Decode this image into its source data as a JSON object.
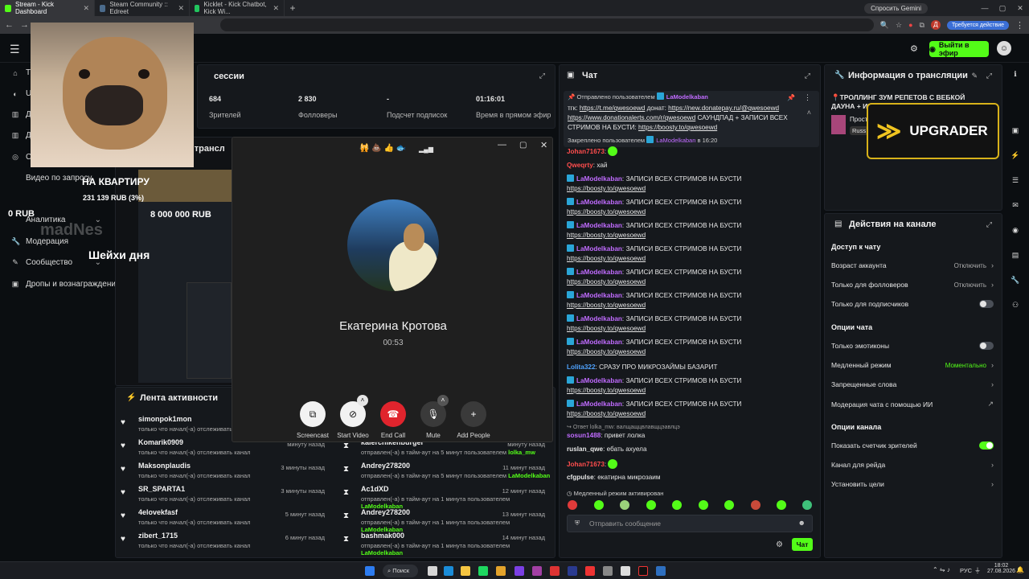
{
  "browser": {
    "tabs": [
      {
        "label": "Stream - Kick Dashboard",
        "color": "#53fc18",
        "active": true
      },
      {
        "label": "Steam Community :: Edreet",
        "color": "#1b2838",
        "active": false
      },
      {
        "label": "Kicklet - Kick Chatbot, Kick Wi...",
        "color": "#22c55e",
        "active": false
      }
    ],
    "gemini_label": "Спросить Gemini",
    "update_label": "Требуется действие"
  },
  "header": {
    "go_live_label": "Выйти в эфир"
  },
  "sidebar": {
    "items": [
      {
        "label": "Тр",
        "icon": "home-icon"
      },
      {
        "label": "Ul",
        "icon": "user-icon"
      },
      {
        "label": "Д",
        "icon": "chart-icon"
      },
      {
        "label": "Д",
        "icon": "chart-icon"
      },
      {
        "label": "Ст",
        "icon": "stream-icon"
      },
      {
        "label": "Видео по запросу",
        "icon": "video-icon"
      },
      {
        "label": "Аналитика",
        "icon": "analytics-icon"
      },
      {
        "label": "Модерация",
        "icon": "wrench-icon"
      },
      {
        "label": "Сообщество",
        "icon": "community-icon"
      },
      {
        "label": "Дропы и вознаграждения",
        "icon": "gift-icon"
      }
    ]
  },
  "overlay": {
    "goal_title": "НА КВАРТИРУ",
    "goal_progress": "231 139 RUB (3%)",
    "goal_target": "8 000 000 RUB",
    "balance": "0 RUB",
    "sub_text": "Шейхи дня",
    "watermark": "madNes"
  },
  "session": {
    "title": "сессии",
    "stats": [
      {
        "value": "684",
        "label": "Зрителей"
      },
      {
        "value": "2 830",
        "label": "Фолловеры"
      },
      {
        "value": "-",
        "label": "Подсчет подписок"
      },
      {
        "value": "01:16:01",
        "label": "Время в прямом эфир"
      }
    ]
  },
  "preview_title": "р трансл",
  "activity": {
    "title": "Лента активности",
    "follows": [
      {
        "name": "simonpok1mon",
        "desc": "только что начал(-а) отслеживать канал",
        "time": ""
      },
      {
        "name": "Komarik0909",
        "desc": "только что начал(-а) отслеживать канал",
        "time": "минуту назад"
      },
      {
        "name": "Maksonplaudis",
        "desc": "только что начал(-а) отслеживать канал",
        "time": "3 минуты назад"
      },
      {
        "name": "SR_SPARTA1",
        "desc": "только что начал(-а) отслеживать канал",
        "time": "3 минуты назад"
      },
      {
        "name": "4elovekfasf",
        "desc": "только что начал(-а) отслеживать канал",
        "time": "5 минут назад"
      },
      {
        "name": "zibert_1715",
        "desc": "только что начал(-а) отслеживать канал",
        "time": "6 минут назад"
      }
    ],
    "timeouts": [
      {
        "name": "kalerchikenburger",
        "desc": "отправлен(-а) в тайм-аут на 5 минут пользователем ",
        "mod": "lolka_mw",
        "time": "минуту назад"
      },
      {
        "name": "Andrey278200",
        "desc": "отправлен(-а) в тайм-аут на 5 минут пользователем ",
        "mod": "LaModelkaban",
        "time": "11 минут назад"
      },
      {
        "name": "Ac1dXD",
        "desc": "отправлен(-а) в тайм-аут на 1 минута пользователем ",
        "mod": "LaModelkaban",
        "time": "12 минут назад"
      },
      {
        "name": "Andrey278200",
        "desc": "отправлен(-а) в тайм-аут на 1 минута пользователем ",
        "mod": "LaModelkaban",
        "time": "13 минут назад"
      },
      {
        "name": "bashmak000",
        "desc": "отправлен(-а) в тайм-аут на 1 минута пользователем ",
        "mod": "LaModelkaban",
        "time": "14 минут назад"
      }
    ]
  },
  "call": {
    "caller_name": "Екатерина Кротова",
    "duration": "00:53",
    "reactions": "🙀 💩 👍 🐟",
    "buttons": [
      {
        "label": "Screencast",
        "icon": "screencast-icon"
      },
      {
        "label": "Start Video",
        "icon": "camera-off-icon"
      },
      {
        "label": "End Call",
        "icon": "end-call-icon"
      },
      {
        "label": "Mute",
        "icon": "microphone-icon"
      },
      {
        "label": "Add People",
        "icon": "add-person-icon"
      }
    ]
  },
  "chat": {
    "title": "Чат",
    "pinned_by_prefix": "Отправлено пользователем",
    "pinned_by_user": "LaModelkaban",
    "pinned_text_1": "тгк: ",
    "pinned_link_1": "https://t.me/qwesoewd",
    "pinned_text_2": " донат: ",
    "pinned_link_2": "https://new.donatepay.ru/@qwesoewd",
    "pinned_link_3": "https://www.donationalerts.com/r/qwesoewd",
    "pinned_text_3": " САУНДПАД + ЗАПИСИ ВСЕХ СТРИМОВ НА БУСТИ: ",
    "pinned_link_4": "https://boosty.to/qwesoewd",
    "pinned_footer_prefix": "Закреплено пользователем",
    "pinned_footer_user": "LaModelkaban",
    "pinned_footer_time": "в 16:20",
    "messages": [
      {
        "user": "Johan71673",
        "color": "#ff4d4d",
        "text": "",
        "emote": true
      },
      {
        "user": "Qweqrty",
        "color": "#ff4d4d",
        "text": "хай"
      },
      {
        "user": "LaModelkaban",
        "color": "#c06bff",
        "badge": true,
        "text": "ЗАПИСИ ВСЕХ СТРИМОВ НА БУСТИ",
        "link": "https://boosty.to/qwesoewd"
      },
      {
        "user": "LaModelkaban",
        "color": "#c06bff",
        "badge": true,
        "text": "ЗАПИСИ ВСЕХ СТРИМОВ НА БУСТИ",
        "link": "https://boosty.to/qwesoewd"
      },
      {
        "user": "LaModelkaban",
        "color": "#c06bff",
        "badge": true,
        "text": "ЗАПИСИ ВСЕХ СТРИМОВ НА БУСТИ",
        "link": "https://boosty.to/qwesoewd"
      },
      {
        "user": "LaModelkaban",
        "color": "#c06bff",
        "badge": true,
        "text": "ЗАПИСИ ВСЕХ СТРИМОВ НА БУСТИ",
        "link": "https://boosty.to/qwesoewd"
      },
      {
        "user": "LaModelkaban",
        "color": "#c06bff",
        "badge": true,
        "text": "ЗАПИСИ ВСЕХ СТРИМОВ НА БУСТИ",
        "link": "https://boosty.to/qwesoewd"
      },
      {
        "user": "LaModelkaban",
        "color": "#c06bff",
        "badge": true,
        "text": "ЗАПИСИ ВСЕХ СТРИМОВ НА БУСТИ",
        "link": "https://boosty.to/qwesoewd"
      },
      {
        "user": "LaModelkaban",
        "color": "#c06bff",
        "badge": true,
        "text": "ЗАПИСИ ВСЕХ СТРИМОВ НА БУСТИ",
        "link": "https://boosty.to/qwesoewd"
      },
      {
        "user": "LaModelkaban",
        "color": "#c06bff",
        "badge": true,
        "text": "ЗАПИСИ ВСЕХ СТРИМОВ НА БУСТИ",
        "link": "https://boosty.to/qwesoewd"
      },
      {
        "user": "Lolita322",
        "color": "#4fa3ff",
        "text": "СРАЗУ ПРО МИКРОЗАЙМЫ БАЗАРИТ"
      },
      {
        "user": "LaModelkaban",
        "color": "#c06bff",
        "badge": true,
        "text": "ЗАПИСИ ВСЕХ СТРИМОВ НА БУСТИ",
        "link": "https://boosty.to/qwesoewd"
      },
      {
        "user": "LaModelkaban",
        "color": "#c06bff",
        "badge": true,
        "text": "ЗАПИСИ ВСЕХ СТРИМОВ НА БУСТИ",
        "link": "https://boosty.to/qwesoewd"
      }
    ],
    "reply_note": "Ответ lolka_mw: валщащцвлавщцэавлцэ",
    "tail": [
      {
        "user": "sosun1488",
        "color": "#c06bff",
        "text": "привет лолка"
      },
      {
        "user": "ruslan_qwe",
        "color": "#e6e6e6",
        "text": "ебать ахуела"
      },
      {
        "user": "Johan71673",
        "color": "#ff4d4d",
        "text": "",
        "emote": true
      },
      {
        "user": "cfgpulse",
        "color": "#e6e6e6",
        "text": "екатирна микрозаим"
      }
    ],
    "slow_mode_note": "Медленный режим активирован",
    "input_placeholder": "Отправить сообщение",
    "send_label": "Чат"
  },
  "stream_info": {
    "title": "Информация о трансляции",
    "stream_title": "ТРОЛЛИНГ ЗУМ РЕПЕТОВ С ВЕБКОЙ ДАУНА + ИЩУ ЖИРУ",
    "category": "Прост",
    "tag": "Russ",
    "sponsor": "UPGRADER"
  },
  "channel_actions": {
    "title": "Действия на канале",
    "chat_access_header": "Доступ к чату",
    "chat_access": [
      {
        "label": "Возраст аккаунта",
        "value": "Отключить",
        "type": "select"
      },
      {
        "label": "Только для фолловеров",
        "value": "Отключить",
        "type": "select"
      },
      {
        "label": "Только для подписчиков",
        "value": "",
        "type": "toggle",
        "on": false
      }
    ],
    "chat_options_header": "Опции чата",
    "chat_options": [
      {
        "label": "Только эмотиконы",
        "value": "",
        "type": "toggle",
        "on": false
      },
      {
        "label": "Медленный режим",
        "value": "Моментально",
        "type": "select"
      },
      {
        "label": "Запрещенные слова",
        "value": "",
        "type": "link"
      },
      {
        "label": "Модерация чата с помощью ИИ",
        "value": "",
        "type": "external"
      }
    ],
    "channel_options_header": "Опции канала",
    "channel_options": [
      {
        "label": "Показать счетчик зрителей",
        "value": "",
        "type": "toggle",
        "on": true
      },
      {
        "label": "Канал для рейда",
        "value": "",
        "type": "link"
      },
      {
        "label": "Установить цели",
        "value": "",
        "type": "link"
      }
    ]
  },
  "taskbar": {
    "search_label": "Поиск",
    "lang": "РУС",
    "time": "18:02",
    "date": "27.08.2026"
  },
  "colors": {
    "accent": "#53fc18",
    "panel": "#15181c",
    "bg": "#0b0e11"
  }
}
